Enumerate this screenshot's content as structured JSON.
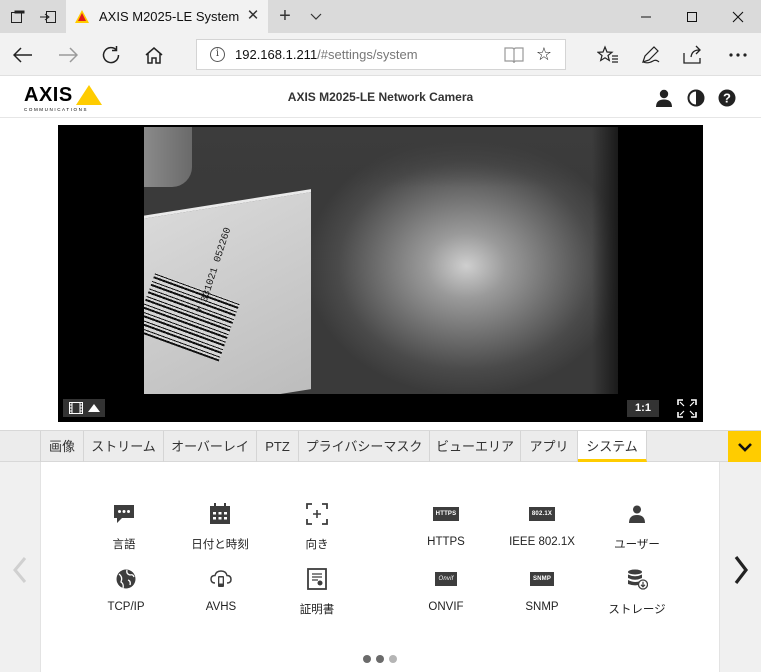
{
  "browser": {
    "tab_title": "AXIS M2025-LE System",
    "url_host": "192.168.1.211",
    "url_path": "/#settings/system"
  },
  "camera": {
    "logo_text": "AXIS",
    "logo_sub": "COMMUNICATIONS",
    "title": "AXIS M2025-LE Network Camera",
    "barcode_number": "7 331021 052260",
    "ratio_label": "1:1"
  },
  "tabs": [
    {
      "label": "画像",
      "active": false
    },
    {
      "label": "ストリーム",
      "active": false
    },
    {
      "label": "オーバーレイ",
      "active": false
    },
    {
      "label": "PTZ",
      "active": false
    },
    {
      "label": "プライバシーマスク",
      "active": false
    },
    {
      "label": "ビューエリア",
      "active": false
    },
    {
      "label": "アプリ",
      "active": false
    },
    {
      "label": "システム",
      "active": true
    }
  ],
  "system_items": [
    {
      "label": "言語",
      "icon": "chat-icon"
    },
    {
      "label": "日付と時刻",
      "icon": "calendar-icon"
    },
    {
      "label": "向き",
      "icon": "orientation-icon"
    },
    {
      "label": "HTTPS",
      "icon": "https-badge-icon",
      "badge": "HTTPS"
    },
    {
      "label": "IEEE 802.1X",
      "icon": "ieee-badge-icon",
      "badge": "802.1X"
    },
    {
      "label": "ユーザー",
      "icon": "user-icon"
    },
    {
      "label": "TCP/IP",
      "icon": "network-globe-icon"
    },
    {
      "label": "AVHS",
      "icon": "cloud-device-icon"
    },
    {
      "label": "証明書",
      "icon": "certificate-icon"
    },
    {
      "label": "ONVIF",
      "icon": "onvif-badge-icon",
      "badge": "Onvif"
    },
    {
      "label": "SNMP",
      "icon": "snmp-badge-icon",
      "badge": "SNMP"
    },
    {
      "label": "ストレージ",
      "icon": "storage-icon"
    }
  ],
  "colors": {
    "accent": "#ffcc00",
    "tab_bg": "#ececec",
    "panel_bg": "#ffffff"
  }
}
